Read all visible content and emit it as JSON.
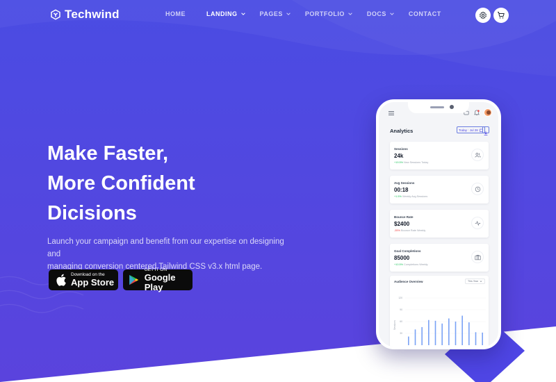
{
  "brand": {
    "name": "Techwind"
  },
  "nav": {
    "items": [
      {
        "label": "HOME",
        "dropdown": false,
        "active": false
      },
      {
        "label": "LANDING",
        "dropdown": true,
        "active": true
      },
      {
        "label": "PAGES",
        "dropdown": true,
        "active": false
      },
      {
        "label": "PORTFOLIO",
        "dropdown": true,
        "active": false
      },
      {
        "label": "DOCS",
        "dropdown": true,
        "active": false
      },
      {
        "label": "CONTACT",
        "dropdown": false,
        "active": false
      }
    ],
    "icons": [
      "gear-icon",
      "cart-icon"
    ]
  },
  "hero": {
    "title_lines": [
      "Make Faster,",
      "More Confident",
      "Dicisions"
    ],
    "lead_lines": [
      "Launch your campaign and benefit from our expertise on designing and",
      "managing conversion centered Tailwind CSS v3.x html page."
    ],
    "app_store": {
      "small": "Download on the",
      "big": "App Store"
    },
    "google_play": {
      "small": "GET IT ON",
      "big": "Google Play"
    }
  },
  "phone": {
    "title": "Analytics",
    "date_label": "Today : Jul 28",
    "cards": [
      {
        "label": "Sessions",
        "value": "24k",
        "change": "+19.5%",
        "change_dir": "up",
        "note": "New Sessions Today",
        "icon": "users-icon"
      },
      {
        "label": "Avg Sessions",
        "value": "00:18",
        "change": "+1.5%",
        "change_dir": "up",
        "note": "Weekly Avg.Sessions",
        "icon": "clock-icon"
      },
      {
        "label": "Bounce Rate",
        "value": "$2400",
        "change": "-35%",
        "change_dir": "down",
        "note": "Bounce Rate Weekly",
        "icon": "activity-icon"
      },
      {
        "label": "Goal Completions",
        "value": "85000",
        "change": "+10.5%",
        "change_dir": "up",
        "note": "Completions Weekly",
        "icon": "briefcase-icon"
      }
    ],
    "chart_title": "Audience Overview",
    "chart_select": "This Year",
    "chart_data": {
      "type": "bar",
      "ylabel": "Sessions",
      "yticks": [
        "120",
        "90",
        "60",
        "30"
      ],
      "ylim": [
        0,
        120
      ],
      "values": [
        22,
        40,
        46,
        64,
        62,
        55,
        68,
        60,
        75,
        58,
        33,
        32
      ]
    }
  },
  "colors": {
    "bg_top": "#4c47e3",
    "bg_bottom": "#5a43dd",
    "accent": "#4f46e5",
    "bar": "#7aa2f5",
    "diamond": "#4f46e5"
  }
}
